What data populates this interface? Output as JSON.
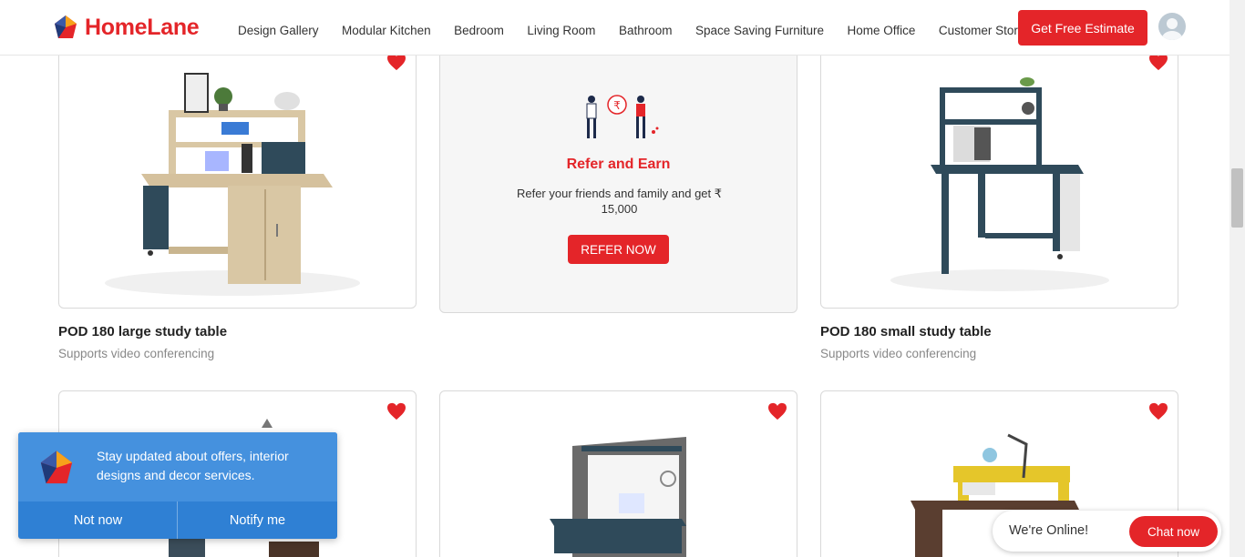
{
  "header": {
    "brand": "HomeLane",
    "nav": [
      "Design Gallery",
      "Modular Kitchen",
      "Bedroom",
      "Living Room",
      "Bathroom",
      "Space Saving Furniture",
      "Home Office",
      "Customer Stories"
    ],
    "cta": "Get Free Estimate"
  },
  "products": [
    {
      "title": "POD 180 large study table",
      "subtitle": "Supports video conferencing",
      "favorite": true
    },
    {
      "title": "POD 180 small study table",
      "subtitle": "Supports video conferencing",
      "favorite": true
    }
  ],
  "refer": {
    "title": "Refer and Earn",
    "text": "Refer your friends and family and get ₹ 15,000",
    "button": "REFER NOW"
  },
  "notification": {
    "text": "Stay updated about offers, interior designs and decor services.",
    "decline": "Not now",
    "accept": "Notify me"
  },
  "chat": {
    "status": "We're Online!",
    "button": "Chat now"
  },
  "colors": {
    "brand_red": "#e42529",
    "notify_blue": "#4591de",
    "notify_dark": "#2f80d4"
  }
}
